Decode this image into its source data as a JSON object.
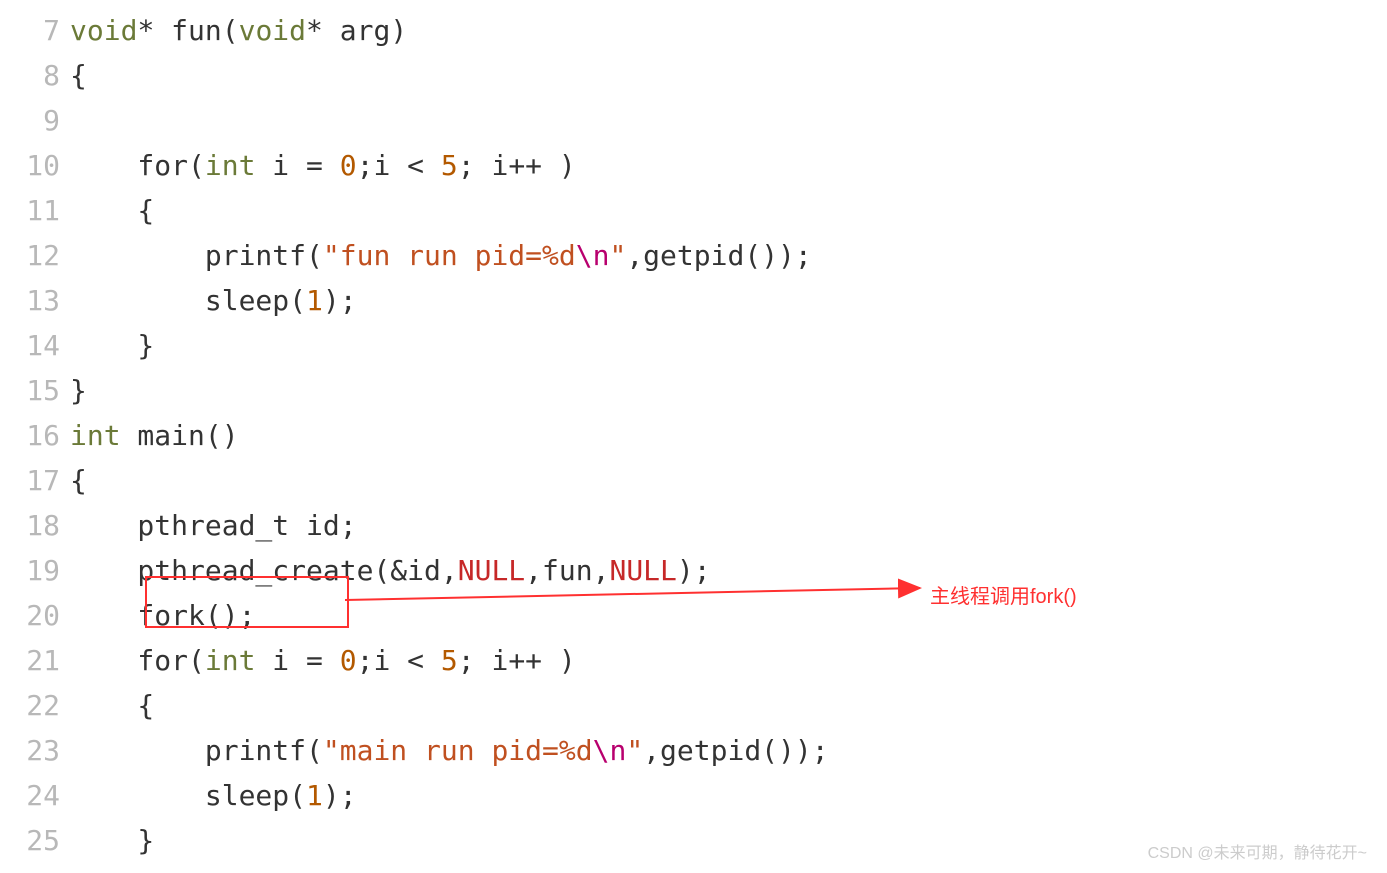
{
  "lines": [
    {
      "n": 7,
      "segments": [
        [
          "kw-type",
          "void"
        ],
        [
          "plain",
          "* fun("
        ],
        [
          "kw-type",
          "void"
        ],
        [
          "plain",
          "* arg)"
        ]
      ]
    },
    {
      "n": 8,
      "segments": [
        [
          "plain",
          "{"
        ]
      ]
    },
    {
      "n": 9,
      "segments": [
        [
          "plain",
          ""
        ]
      ]
    },
    {
      "n": 10,
      "segments": [
        [
          "plain",
          "    for("
        ],
        [
          "kw-type",
          "int"
        ],
        [
          "plain",
          " i = "
        ],
        [
          "num",
          "0"
        ],
        [
          "plain",
          ";i < "
        ],
        [
          "num",
          "5"
        ],
        [
          "plain",
          "; i++ )"
        ]
      ]
    },
    {
      "n": 11,
      "segments": [
        [
          "plain",
          "    {"
        ]
      ]
    },
    {
      "n": 12,
      "segments": [
        [
          "plain",
          "        printf("
        ],
        [
          "str",
          "\"fun run pid=%d"
        ],
        [
          "esc",
          "\\n"
        ],
        [
          "str",
          "\""
        ],
        [
          "plain",
          ",getpid());"
        ]
      ]
    },
    {
      "n": 13,
      "segments": [
        [
          "plain",
          "        sleep("
        ],
        [
          "num",
          "1"
        ],
        [
          "plain",
          ");"
        ]
      ]
    },
    {
      "n": 14,
      "segments": [
        [
          "plain",
          "    }"
        ]
      ]
    },
    {
      "n": 15,
      "segments": [
        [
          "plain",
          "}"
        ]
      ]
    },
    {
      "n": 16,
      "segments": [
        [
          "kw-type",
          "int"
        ],
        [
          "plain",
          " main()"
        ]
      ]
    },
    {
      "n": 17,
      "segments": [
        [
          "plain",
          "{"
        ]
      ]
    },
    {
      "n": 18,
      "segments": [
        [
          "plain",
          "    pthread_t id;"
        ]
      ]
    },
    {
      "n": 19,
      "segments": [
        [
          "plain",
          "    pthread_create(&id,"
        ],
        [
          "kw-null",
          "NULL"
        ],
        [
          "plain",
          ",fun,"
        ],
        [
          "kw-null",
          "NULL"
        ],
        [
          "plain",
          ");"
        ]
      ]
    },
    {
      "n": 20,
      "segments": [
        [
          "plain",
          "    fork();"
        ]
      ]
    },
    {
      "n": 21,
      "segments": [
        [
          "plain",
          "    for("
        ],
        [
          "kw-type",
          "int"
        ],
        [
          "plain",
          " i = "
        ],
        [
          "num",
          "0"
        ],
        [
          "plain",
          ";i < "
        ],
        [
          "num",
          "5"
        ],
        [
          "plain",
          "; i++ )"
        ]
      ]
    },
    {
      "n": 22,
      "segments": [
        [
          "plain",
          "    {"
        ]
      ]
    },
    {
      "n": 23,
      "segments": [
        [
          "plain",
          "        printf("
        ],
        [
          "str",
          "\"main run pid=%d"
        ],
        [
          "esc",
          "\\n"
        ],
        [
          "str",
          "\""
        ],
        [
          "plain",
          ",getpid());"
        ]
      ]
    },
    {
      "n": 24,
      "segments": [
        [
          "plain",
          "        sleep("
        ],
        [
          "num",
          "1"
        ],
        [
          "plain",
          ");"
        ]
      ]
    },
    {
      "n": 25,
      "segments": [
        [
          "plain",
          "    }"
        ]
      ]
    }
  ],
  "annotation": "主线程调用fork()",
  "watermark": "CSDN @未来可期，静待花开~"
}
